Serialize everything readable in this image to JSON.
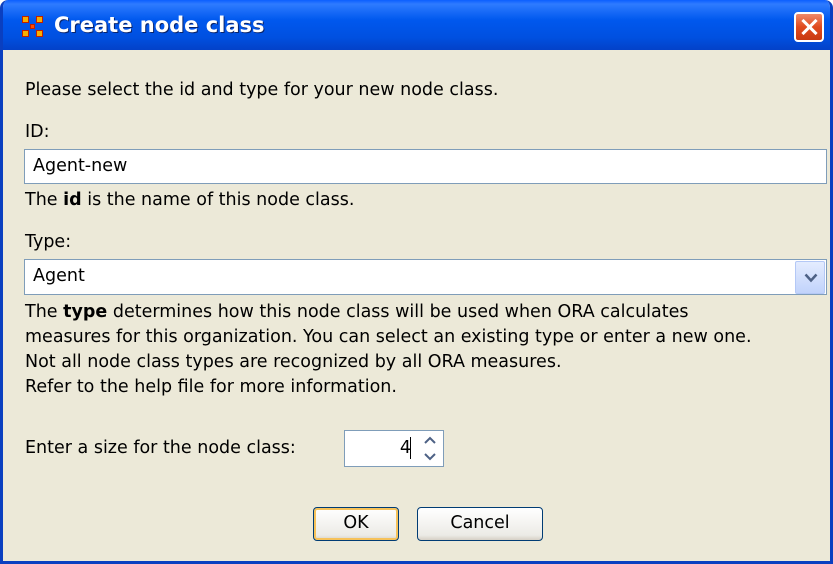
{
  "dialog": {
    "title": "Create node class",
    "intro": "Please select the id and type for your new node class.",
    "id_label": "ID:",
    "id_value": "Agent-new",
    "id_help": {
      "pre": "The ",
      "bold": "id",
      "post": " is the name of this node class."
    },
    "type_label": "Type:",
    "type_value": "Agent",
    "type_help": {
      "pre": "The ",
      "bold": "type",
      "line1_post": " determines how this node class will be used when ORA calculates",
      "line2": "measures for this organization. You can select an existing type or enter a new one.",
      "line3": "Not all node class types are recognized by all ORA measures.",
      "line4": "Refer to the help file for more information."
    },
    "size_label": "Enter a size for the node class:",
    "size_value": "4",
    "ok_label": "OK",
    "cancel_label": "Cancel"
  },
  "icons": [
    "app-icon",
    "close-icon",
    "dropdown-arrow-icon",
    "spin-up-icon",
    "spin-down-icon"
  ],
  "colors": {
    "titlebar": "#0058EE",
    "dialog_bg": "#ECE9D8",
    "close": "#E04A1E",
    "field_border": "#7F9DB9"
  }
}
